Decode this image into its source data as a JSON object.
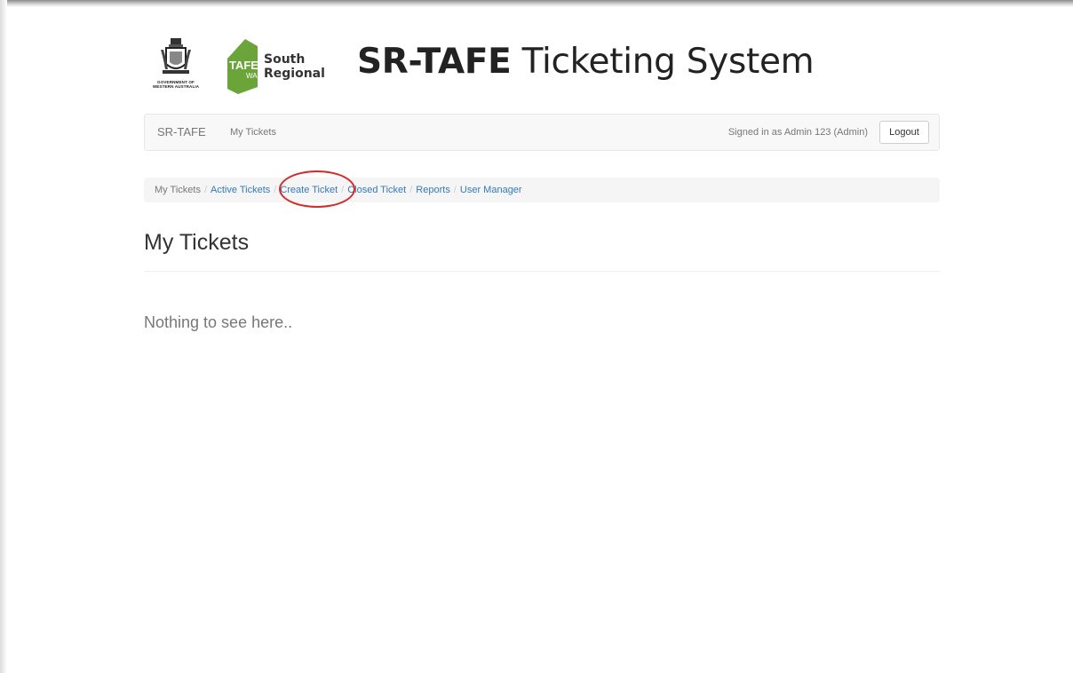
{
  "header": {
    "gov_caption_line1": "GOVERNMENT OF",
    "gov_caption_line2": "WESTERN AUSTRALIA",
    "tafe_mark": "TAFE",
    "tafe_sub": "WA",
    "tafe_line1": "South",
    "tafe_line2": "Regional",
    "title_bold": "SR-TAFE",
    "title_light": "Ticketing System"
  },
  "navbar": {
    "brand": "SR-TAFE",
    "link": "My Tickets",
    "signed_in": "Signed in as Admin 123 (Admin)",
    "logout_label": "Logout"
  },
  "breadcrumb": {
    "current": "My Tickets",
    "items": [
      "Active Tickets",
      "Create Ticket",
      "Closed Ticket",
      "Reports",
      "User Manager"
    ],
    "separator": "/"
  },
  "page": {
    "title": "My Tickets",
    "empty_message": "Nothing to see here.."
  },
  "colors": {
    "link": "#337ab7",
    "tafe_green": "#6ba539",
    "highlight": "#d42a2a"
  }
}
